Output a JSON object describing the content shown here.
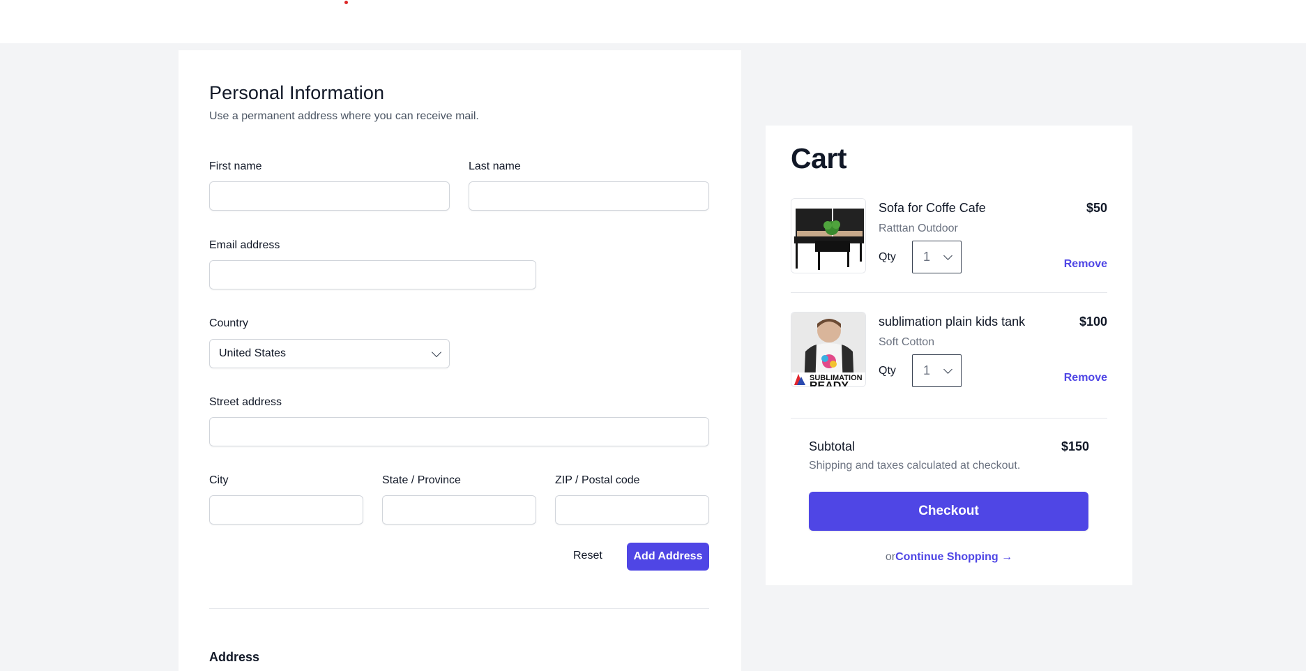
{
  "form": {
    "title": "Personal Information",
    "subtitle": "Use a permanent address where you can receive mail.",
    "first_name_label": "First name",
    "last_name_label": "Last name",
    "email_label": "Email address",
    "country_label": "Country",
    "country_value": "United States",
    "street_label": "Street address",
    "city_label": "City",
    "state_label": "State / Province",
    "zip_label": "ZIP / Postal code",
    "reset_label": "Reset",
    "add_label": "Add Address",
    "address_heading": "Address"
  },
  "cart": {
    "title": "Cart",
    "items": [
      {
        "name": "Sofa for Coffe Cafe",
        "variant": "Ratttan Outdoor",
        "price": "$50",
        "qty_label": "Qty",
        "qty": "1",
        "remove_label": "Remove",
        "image": "rattan-sofa-set"
      },
      {
        "name": "sublimation plain kids tank",
        "variant": "Soft Cotton",
        "price": "$100",
        "qty_label": "Qty",
        "qty": "1",
        "remove_label": "Remove",
        "image": "kids-raglan-shirt",
        "image_text": "SUBLIMATION",
        "image_text2": "READY"
      }
    ],
    "subtotal_label": "Subtotal",
    "subtotal_value": "$150",
    "shipping_note": "Shipping and taxes calculated at checkout.",
    "checkout_label": "Checkout",
    "or_text": "or",
    "continue_label": "Continue Shopping →"
  },
  "colors": {
    "accent": "#4f46e5",
    "background": "#f3f4f6",
    "card": "#ffffff"
  }
}
